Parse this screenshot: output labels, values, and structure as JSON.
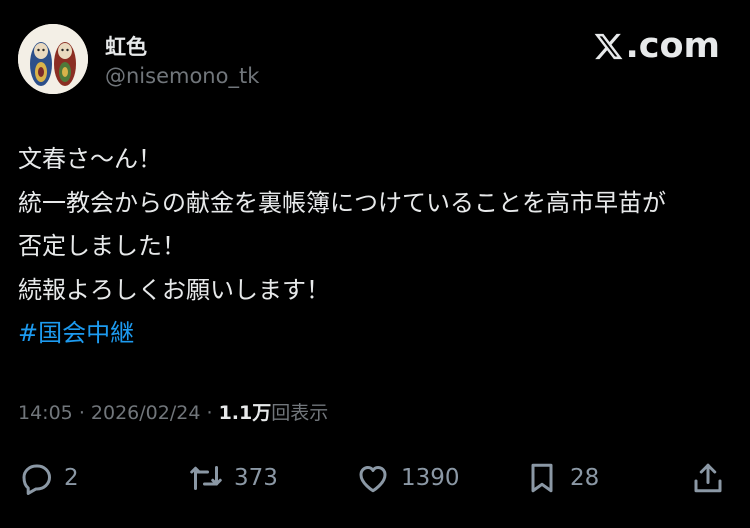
{
  "author": {
    "display_name": "虹色",
    "handle": "@nisemono_tk"
  },
  "brand": {
    "label": ".com",
    "icon": "x-logo-icon"
  },
  "post": {
    "lines": [
      "文春さ〜ん！",
      "統一教会からの献金を裏帳簿につけていることを高市早苗が",
      "否定しました！",
      "続報よろしくお願いします！"
    ],
    "hashtag": "#国会中継"
  },
  "meta": {
    "time": "14:05",
    "separator": "·",
    "date": "2026/02/24",
    "views_count": "1.1万",
    "views_label": "回表示"
  },
  "actions": {
    "replies": "2",
    "reposts": "373",
    "likes": "1390",
    "bookmarks": "28"
  },
  "colors": {
    "background": "#000000",
    "text": "#e7e9ea",
    "muted": "#71767b",
    "hashtag": "#1d9bf0"
  }
}
